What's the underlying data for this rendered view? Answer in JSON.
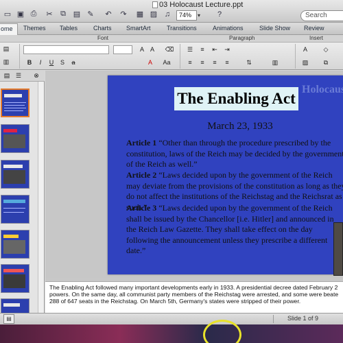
{
  "window": {
    "title": "03 Holocaust Lecture.ppt"
  },
  "toolbar": {
    "zoom_value": "74%",
    "search_placeholder": "Search"
  },
  "ribbon": {
    "tabs": [
      "ome",
      "Themes",
      "Tables",
      "Charts",
      "SmartArt",
      "Transitions",
      "Animations",
      "Slide Show",
      "Review"
    ],
    "active_tab": "ome",
    "groups": [
      "Font",
      "Paragraph",
      "Insert"
    ]
  },
  "slide": {
    "watermark": "Holocaust",
    "title": "The Enabling Act",
    "date": "March 23, 1933",
    "articles": [
      {
        "label": "Article 1",
        "text": "“Other than through the procedure prescribed by the constitution, laws of the Reich may be decided by the government of the Reich as well.”"
      },
      {
        "label": "Article 2",
        "text": "“Laws decided upon by the government of the Reich may deviate from the provisions of the constitution as long as they do not affect the institutions of the Reichstag and the Reichsrat as such.”"
      },
      {
        "label": "Article 3",
        "text": "“Laws decided upon by the government of the Reich shall be issued by the Chancellor [i.e. Hitler] and announced in the Reich Law Gazette. They shall take effect on the day following the announcement unless they prescribe a different date.”"
      }
    ]
  },
  "notes": {
    "lines": [
      "The Enabling Act followed many important developments early in 1933. A presidential decree dated February 2",
      "powers. On the same day, all communist party members of the Reichstag were arrested, and some were beate",
      "288 of 647 seats in the Reichstag. On March 5th, Germany's states were stripped of their power."
    ]
  },
  "status": {
    "slide_indicator": "Slide 1 of 9"
  },
  "thumbnails": [
    {
      "selected": true
    },
    {
      "selected": false
    },
    {
      "selected": false
    },
    {
      "selected": false
    },
    {
      "selected": false
    },
    {
      "selected": false
    },
    {
      "selected": false
    }
  ],
  "colors": {
    "slide_bg": "#3042bf",
    "title_box": "#dff3f6",
    "selection": "#e57a2a"
  }
}
